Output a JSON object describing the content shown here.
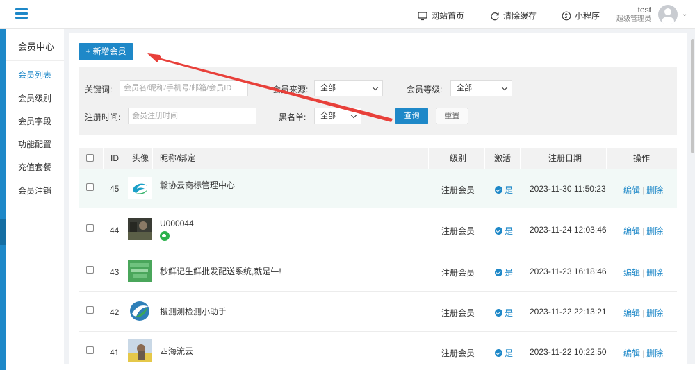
{
  "header": {
    "links": [
      {
        "label": "网站首页",
        "icon": "monitor-icon"
      },
      {
        "label": "清除缓存",
        "icon": "refresh-icon"
      },
      {
        "label": "小程序",
        "icon": "mini-program-icon"
      }
    ],
    "user": {
      "name": "test",
      "role": "超级管理员"
    }
  },
  "sidebar": {
    "title": "会员中心",
    "items": [
      {
        "label": "会员列表",
        "active": true
      },
      {
        "label": "会员级别"
      },
      {
        "label": "会员字段"
      },
      {
        "label": "功能配置"
      },
      {
        "label": "充值套餐"
      },
      {
        "label": "会员注销"
      }
    ]
  },
  "toolbar": {
    "add_label": "+ 新增会员"
  },
  "filter": {
    "keyword_label": "关键词:",
    "keyword_placeholder": "会员名/昵称/手机号/邮箱/会员ID",
    "source_label": "会员来源:",
    "source_value": "全部",
    "level_label": "会员等级:",
    "level_value": "全部",
    "regtime_label": "注册时间:",
    "regtime_placeholder": "会员注册时间",
    "blacklist_label": "黑名单:",
    "blacklist_value": "全部",
    "query_label": "查询",
    "reset_label": "重置"
  },
  "table": {
    "columns": [
      "ID",
      "头像",
      "昵称/绑定",
      "级别",
      "激活",
      "注册日期",
      "操作"
    ],
    "rows": [
      {
        "id": "45",
        "name": "赣协云商标管理中心",
        "level": "注册会员",
        "active": "是",
        "date": "2023-11-30 11:50:23",
        "avatar": "logo-swirl-blue-green",
        "wechat": false
      },
      {
        "id": "44",
        "name": "U000044",
        "level": "注册会员",
        "active": "是",
        "date": "2023-11-24 12:03:46",
        "avatar": "photo-dark",
        "wechat": true
      },
      {
        "id": "43",
        "name": "秒鲜记生鲜批发配送系统,就是牛!",
        "level": "注册会员",
        "active": "是",
        "date": "2023-11-23 16:18:46",
        "avatar": "logo-green-text",
        "wechat": false
      },
      {
        "id": "42",
        "name": "搜测测检测小助手",
        "level": "注册会员",
        "active": "是",
        "date": "2023-11-22 22:13:21",
        "avatar": "logo-circle-green-blue",
        "wechat": false
      },
      {
        "id": "41",
        "name": "四海流云",
        "level": "注册会员",
        "active": "是",
        "date": "2023-11-22 10:22:50",
        "avatar": "photo-field",
        "wechat": false
      }
    ],
    "edit_label": "编辑",
    "delete_label": "删除"
  },
  "colors": {
    "accent": "#1e88c8",
    "annotation_arrow": "#e8403a",
    "wechat": "#2bb24c"
  }
}
